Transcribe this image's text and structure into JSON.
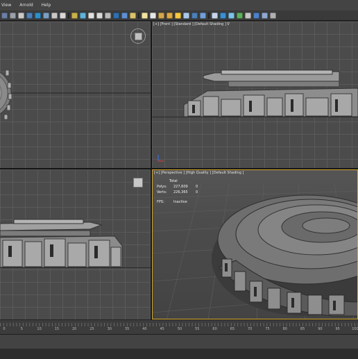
{
  "menu": {
    "items": [
      "View",
      "Arnold",
      "Help"
    ]
  },
  "toolbar": {
    "colors": [
      "#6b7fa6",
      "#9aa0a8",
      "#c9c9c9",
      "#4e7fb8",
      "#2d90c8",
      "#7a9fc3",
      "#c7c7c7",
      "#d8d8d8",
      "#c9b04a",
      "#5eb4d8",
      "#e0e0e0",
      "#d9d9d9",
      "#bbbbbb",
      "#2e6fb0",
      "#5e8fd2",
      "#d9c36a",
      "#f2e4a0",
      "#e6e6e6",
      "#d3a54d",
      "#dba842",
      "#f5c843",
      "#a9c8e8",
      "#4c7fb6",
      "#70a0d8",
      "#c6d6ea",
      "#3a8fd0",
      "#7cc1e8",
      "#5fae5b",
      "#c6c6c6",
      "#4c80c8",
      "#90a8d0",
      "#b0b0b0"
    ]
  },
  "viewports": {
    "top_left": {
      "label": ""
    },
    "top_right": {
      "label": "[+] [Front ] [Standard ] [Default Shading ]  ∇"
    },
    "bottom_left": {
      "label": ""
    },
    "bottom_right": {
      "label": "[+] [Perspective ] [High Quality ] [Default Shading ]"
    }
  },
  "stats": {
    "header": "Total",
    "polys_label": "Polys:",
    "polys_total": "227,609",
    "polys_sel": "0",
    "verts_label": "Verts:",
    "verts_total": "226,365",
    "verts_sel": "0",
    "fps_label": "FPS:",
    "fps_value": "Inactive"
  },
  "timeline": {
    "ticks": [
      "0",
      "5",
      "10",
      "15",
      "20",
      "25",
      "30",
      "35",
      "40",
      "45",
      "50",
      "55",
      "60",
      "65",
      "70",
      "75",
      "80",
      "85",
      "90",
      "95",
      "100"
    ]
  }
}
